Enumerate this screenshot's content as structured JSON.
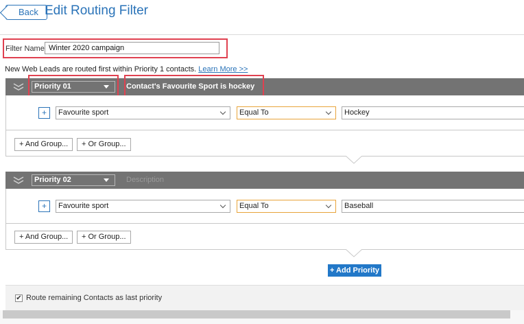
{
  "header": {
    "back_label": "Back",
    "title": "Edit Routing Filter"
  },
  "filter_name": {
    "label": "Filter Name",
    "value": "Winter 2020 campaign"
  },
  "info": {
    "text": "New Web Leads are routed first within Priority 1 contacts. ",
    "link": "Learn More >>"
  },
  "priorities": [
    {
      "selected": "Priority 01",
      "description": "Contact's Favourite Sport is hockey",
      "rule": {
        "field": "Favourite sport",
        "operator": "Equal To",
        "value": "Hockey"
      },
      "and_group_label": "+ And Group...",
      "or_group_label": "+ Or Group..."
    },
    {
      "selected": "Priority 02",
      "description_placeholder": "Description",
      "rule": {
        "field": "Favourite sport",
        "operator": "Equal To",
        "value": "Baseball"
      },
      "and_group_label": "+ And Group...",
      "or_group_label": "+ Or Group..."
    }
  ],
  "add_rule_label": "+",
  "add_priority_label": "+ Add Priority",
  "footer": {
    "checkbox_checked": true,
    "checkbox_label": "Route remaining Contacts as last priority"
  },
  "colors": {
    "accent": "#2a73b8",
    "highlight": "#e04150",
    "priority_bar": "#737373",
    "operator_border": "#e8a43a"
  }
}
